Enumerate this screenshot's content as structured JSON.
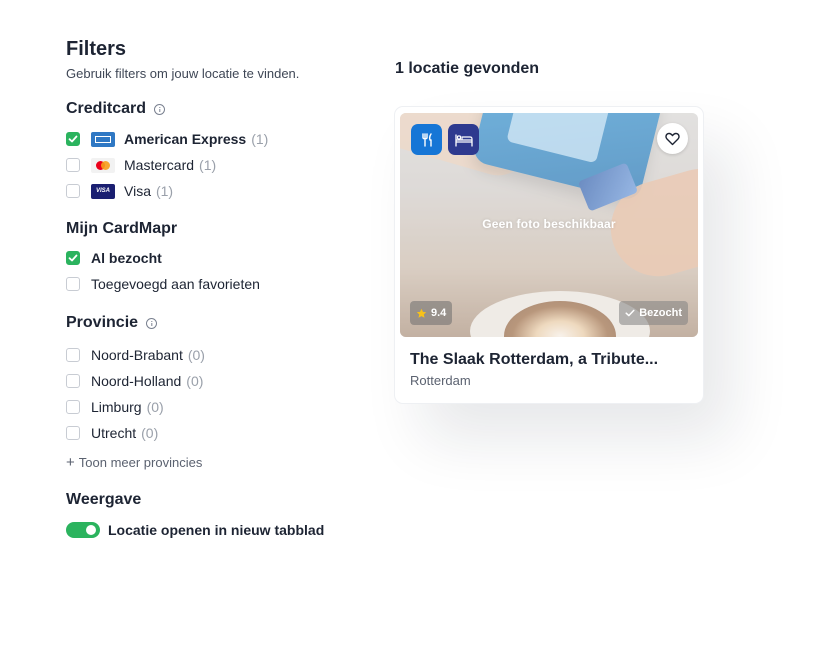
{
  "filters": {
    "title": "Filters",
    "subtitle": "Gebruik filters om jouw locatie te vinden."
  },
  "creditcard": {
    "title": "Creditcard",
    "items": [
      {
        "label": "American Express",
        "count": "(1)",
        "checked": true,
        "icon": "amex-logo"
      },
      {
        "label": "Mastercard",
        "count": "(1)",
        "checked": false,
        "icon": "mastercard-logo"
      },
      {
        "label": "Visa",
        "count": "(1)",
        "checked": false,
        "icon": "visa-logo"
      }
    ],
    "visa_logo_text": "VISA"
  },
  "cardmapr": {
    "title": "Mijn CardMapr",
    "items": [
      {
        "label": "Al bezocht",
        "checked": true
      },
      {
        "label": "Toegevoegd aan favorieten",
        "checked": false
      }
    ]
  },
  "provincie": {
    "title": "Provincie",
    "items": [
      {
        "label": "Noord-Brabant",
        "count": "(0)",
        "checked": false
      },
      {
        "label": "Noord-Holland",
        "count": "(0)",
        "checked": false
      },
      {
        "label": "Limburg",
        "count": "(0)",
        "checked": false
      },
      {
        "label": "Utrecht",
        "count": "(0)",
        "checked": false
      }
    ],
    "more_label": "Toon meer provincies"
  },
  "weergave": {
    "title": "Weergave",
    "toggle_label": "Locatie openen in nieuw tabblad",
    "toggle_on": true
  },
  "results": {
    "title": "1 locatie gevonden",
    "cards": [
      {
        "title": "The Slaak Rotterdam, a Tribute...",
        "city": "Rotterdam",
        "rating": "9.4",
        "visited_label": "Bezocht",
        "photo_text": "Geen foto beschikbaar",
        "categories": [
          "fork-knife-icon",
          "bed-icon"
        ]
      }
    ]
  },
  "colors": {
    "accent_green": "#2bb35e",
    "category_blue": "#1676d6",
    "category_navy": "#2e3a8f",
    "text": "#1d2433"
  }
}
